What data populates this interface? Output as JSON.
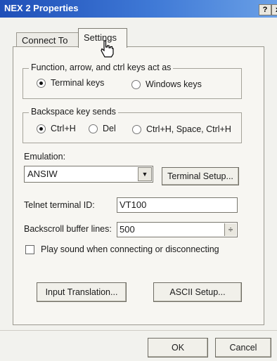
{
  "window": {
    "title": "NEX 2 Properties",
    "help_label": "?",
    "close_label": "x"
  },
  "tabs": [
    {
      "label": "Connect To"
    },
    {
      "label": "Settings"
    }
  ],
  "function_keys": {
    "legend": "Function, arrow, and ctrl keys act as",
    "options": [
      {
        "label": "Terminal keys",
        "selected": true
      },
      {
        "label": "Windows keys",
        "selected": false
      }
    ]
  },
  "backspace": {
    "legend": "Backspace key sends",
    "options": [
      {
        "label": "Ctrl+H",
        "selected": true
      },
      {
        "label": "Del",
        "selected": false
      },
      {
        "label": "Ctrl+H, Space, Ctrl+H",
        "selected": false
      }
    ]
  },
  "emulation": {
    "label": "Emulation:",
    "value": "ANSIW",
    "setup_button": "Terminal Setup..."
  },
  "telnet": {
    "label": "Telnet terminal ID:",
    "value": "VT100"
  },
  "backscroll": {
    "label": "Backscroll buffer lines:",
    "value": "500"
  },
  "play_sound": {
    "label": "Play sound when connecting or disconnecting",
    "checked": false
  },
  "buttons": {
    "input_translation": "Input Translation...",
    "ascii_setup": "ASCII Setup...",
    "ok": "OK",
    "cancel": "Cancel"
  },
  "icons": {
    "cursor": "hand-cursor-icon",
    "dropdown": "chevron-down-icon",
    "spinner": "spinner-icon"
  }
}
